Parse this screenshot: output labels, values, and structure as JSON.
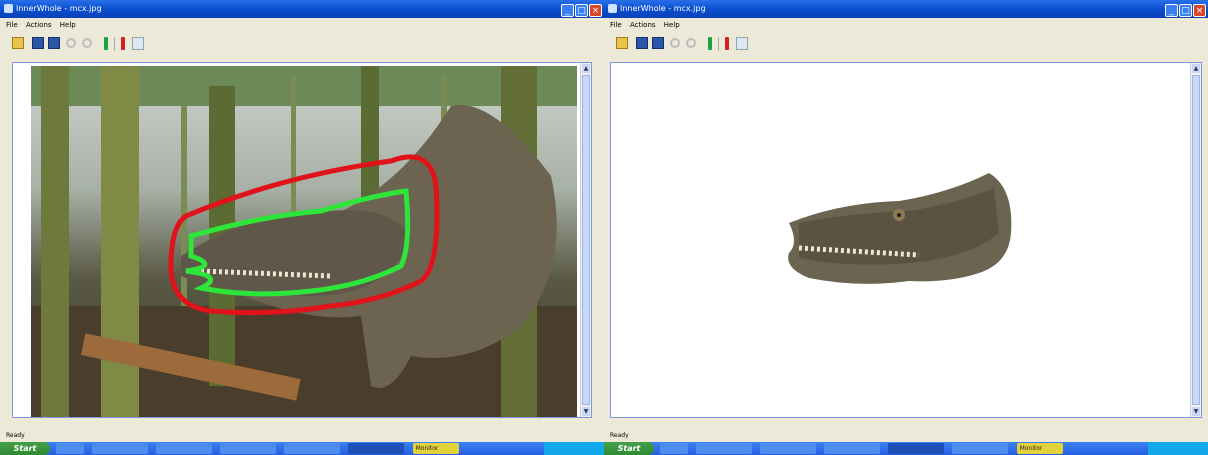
{
  "left_window": {
    "title": "InnerWhole - mcx.jpg",
    "menu": [
      "File",
      "Actions",
      "Help"
    ],
    "status": "Ready"
  },
  "right_window": {
    "title": "InnerWhole - mcx.jpg",
    "menu": [
      "File",
      "Actions",
      "Help"
    ],
    "status": "Ready"
  },
  "toolbar_icons": [
    "open-icon",
    "save-icon",
    "save-as-icon",
    "zoom-in-icon",
    "zoom-out-icon",
    "foreground-marker-icon",
    "background-marker-icon",
    "eraser-icon"
  ],
  "taskbar": {
    "start_label": "Start",
    "left_tasks": [
      "",
      "",
      "",
      "",
      "",
      "",
      "",
      "Monitor",
      ""
    ],
    "right_tasks": [
      "",
      "",
      "",
      "",
      "",
      "",
      "",
      "Monitor",
      ""
    ]
  },
  "colors": {
    "titlebar": "#0a4fd0",
    "foreground_stroke": "#2ee63a",
    "background_stroke": "#e0121a",
    "window_bg": "#ece9d8"
  }
}
